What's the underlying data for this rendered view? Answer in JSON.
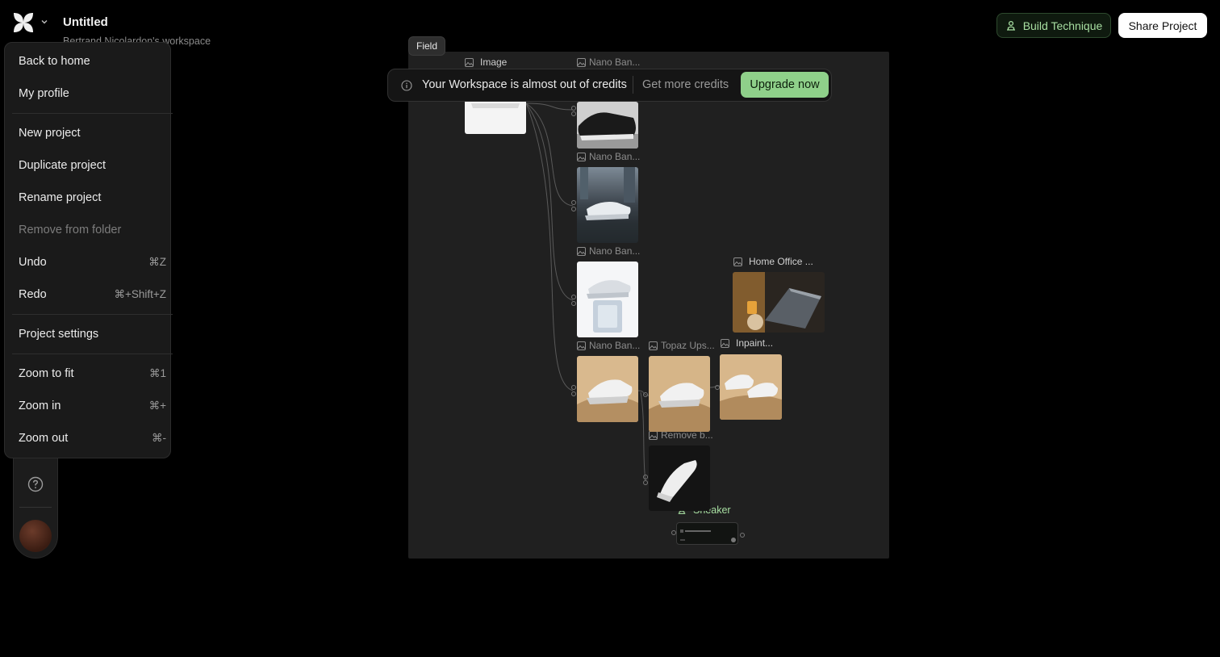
{
  "header": {
    "project_title": "Untitled",
    "workspace_name": "Bertrand Nicolardon's workspace",
    "build_technique_label": "Build Technique",
    "share_project_label": "Share Project"
  },
  "menu": {
    "items": [
      {
        "label": "Back to home",
        "shortcut": ""
      },
      {
        "label": "My profile",
        "shortcut": ""
      },
      {
        "label": "New project",
        "shortcut": ""
      },
      {
        "label": "Duplicate project",
        "shortcut": ""
      },
      {
        "label": "Rename project",
        "shortcut": ""
      },
      {
        "label": "Remove from folder",
        "shortcut": "",
        "disabled": true
      },
      {
        "label": "Undo",
        "shortcut": "⌘Z"
      },
      {
        "label": "Redo",
        "shortcut": "⌘+Shift+Z"
      },
      {
        "label": "Project settings",
        "shortcut": ""
      },
      {
        "label": "Zoom to fit",
        "shortcut": "⌘1"
      },
      {
        "label": "Zoom in",
        "shortcut": "⌘+"
      },
      {
        "label": "Zoom out",
        "shortcut": "⌘-"
      }
    ]
  },
  "canvas": {
    "field_tooltip": "Field",
    "banner": {
      "message": "Your Workspace is almost out of credits",
      "get_more_label": "Get more credits",
      "upgrade_label": "Upgrade now"
    },
    "nodes": {
      "image": "Image",
      "nano_1": "Nano Ban...",
      "nano_2": "Nano Ban...",
      "nano_3": "Nano Ban...",
      "nano_4": "Nano Ban...",
      "home_office": "Home Office ...",
      "inpaint": "Inpaint...",
      "topaz": "Topaz Ups...",
      "remove_bg": "Remove b...",
      "sneaker": "Sneaker"
    }
  },
  "colors": {
    "accent_green": "#8fd08a",
    "background": "#000000",
    "canvas": "#202020"
  },
  "icons": [
    "logo-icon",
    "chevron-down-icon",
    "person-upload-icon",
    "help-icon",
    "info-icon",
    "image-icon"
  ]
}
